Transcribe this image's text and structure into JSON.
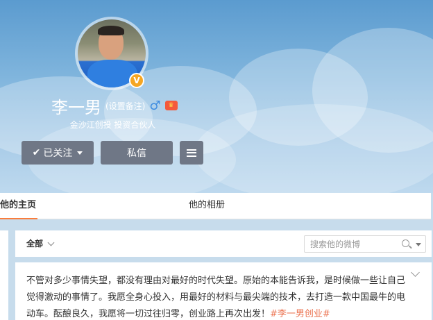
{
  "profile": {
    "name": "李一男",
    "remark": "(设置备注)",
    "gender_icon": "male-icon",
    "member_icon": "vip-member-icon",
    "verified_icon": "verified-v-icon",
    "verified_label": "V",
    "bio": "金沙江创投 投资合伙人"
  },
  "actions": {
    "follow_label": "已关注",
    "message_label": "私信",
    "more_icon": "menu-icon"
  },
  "tabs": [
    {
      "label": "他的主页",
      "active": true
    },
    {
      "label": "他的相册",
      "active": false
    }
  ],
  "feed": {
    "filter_label": "全部",
    "search_placeholder": "搜索他的微博"
  },
  "post": {
    "text": "不管对多少事情失望，都没有理由对最好的时代失望。原始的本能告诉我，是时候做一些让自己觉得激动的事情了。我愿全身心投入，用最好的材料与最尖端的技术，去打造一款中国最牛的电动车。酝酿良久，我愿将一切过往归零，创业路上再次出发！",
    "hashtag": "#李一男创业#"
  },
  "colors": {
    "button_bg": "#6f7786",
    "hashtag": "#eb7350",
    "tab_active": "#fa7d3c",
    "verified": "#f5a623"
  }
}
